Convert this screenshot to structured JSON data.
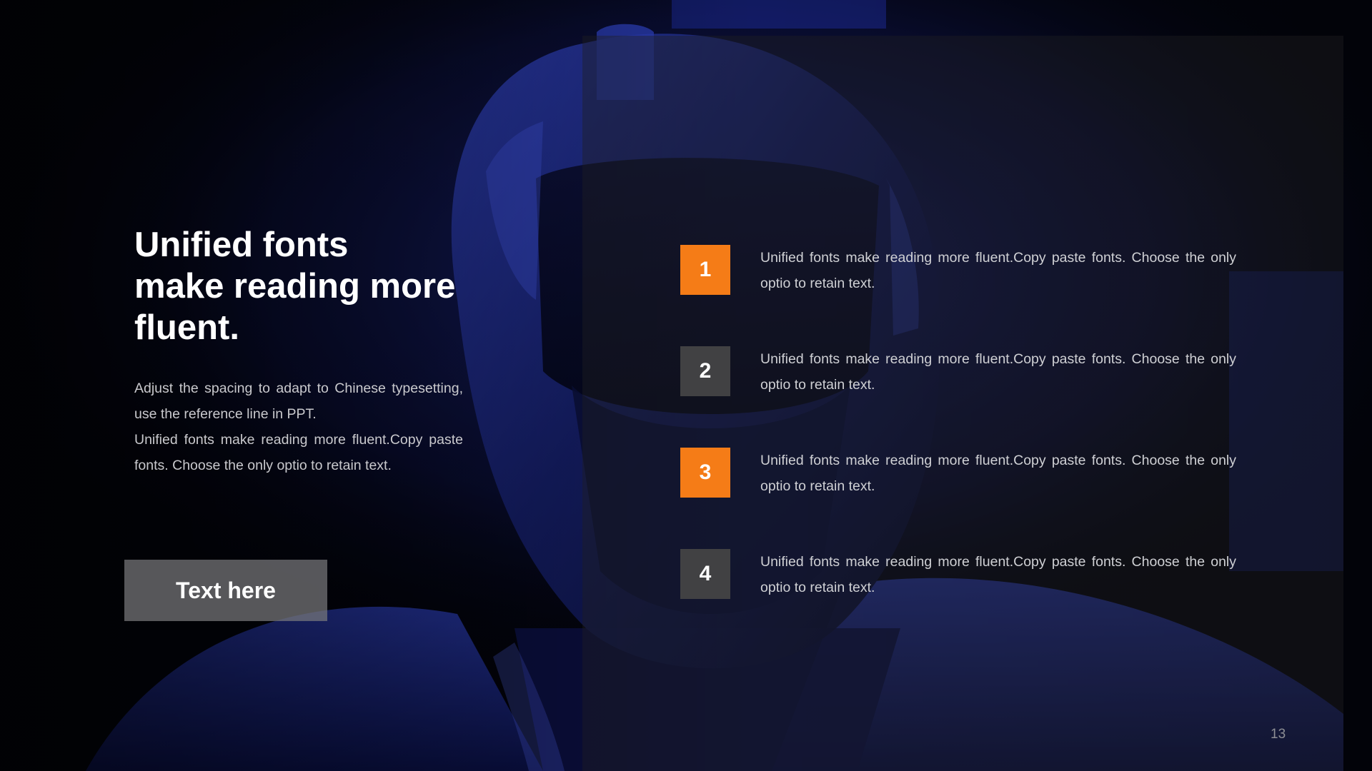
{
  "slide": {
    "title": "Unified fonts\nmake reading more\nfluent.",
    "description": "Adjust the spacing to adapt to Chinese typesetting, use the reference line in PPT.\nUnified fonts make reading more fluent.Copy paste fonts. Choose the only optio to retain text.",
    "button_label": "Text here",
    "page_number": "13",
    "items": [
      {
        "number": "1",
        "text": "Unified fonts make reading more fluent.Copy paste fonts. Choose the only optio to retain text.",
        "color": "#f57c17"
      },
      {
        "number": "2",
        "text": "Unified fonts make reading more fluent.Copy paste fonts. Choose the only optio to retain text.",
        "color": "#414143"
      },
      {
        "number": "3",
        "text": "Unified fonts make reading more fluent.Copy paste fonts. Choose the only optio to retain text.",
        "color": "#f57c17"
      },
      {
        "number": "4",
        "text": "Unified fonts make reading more fluent.Copy paste fonts. Choose the only optio to retain text.",
        "color": "#414143"
      }
    ]
  },
  "theme": {
    "accent": "#f57c17",
    "neutral_box": "#414143",
    "background": "#02030a",
    "figure_tint": "#1d2a8c"
  },
  "background_image": "robot-helmet-silhouette"
}
